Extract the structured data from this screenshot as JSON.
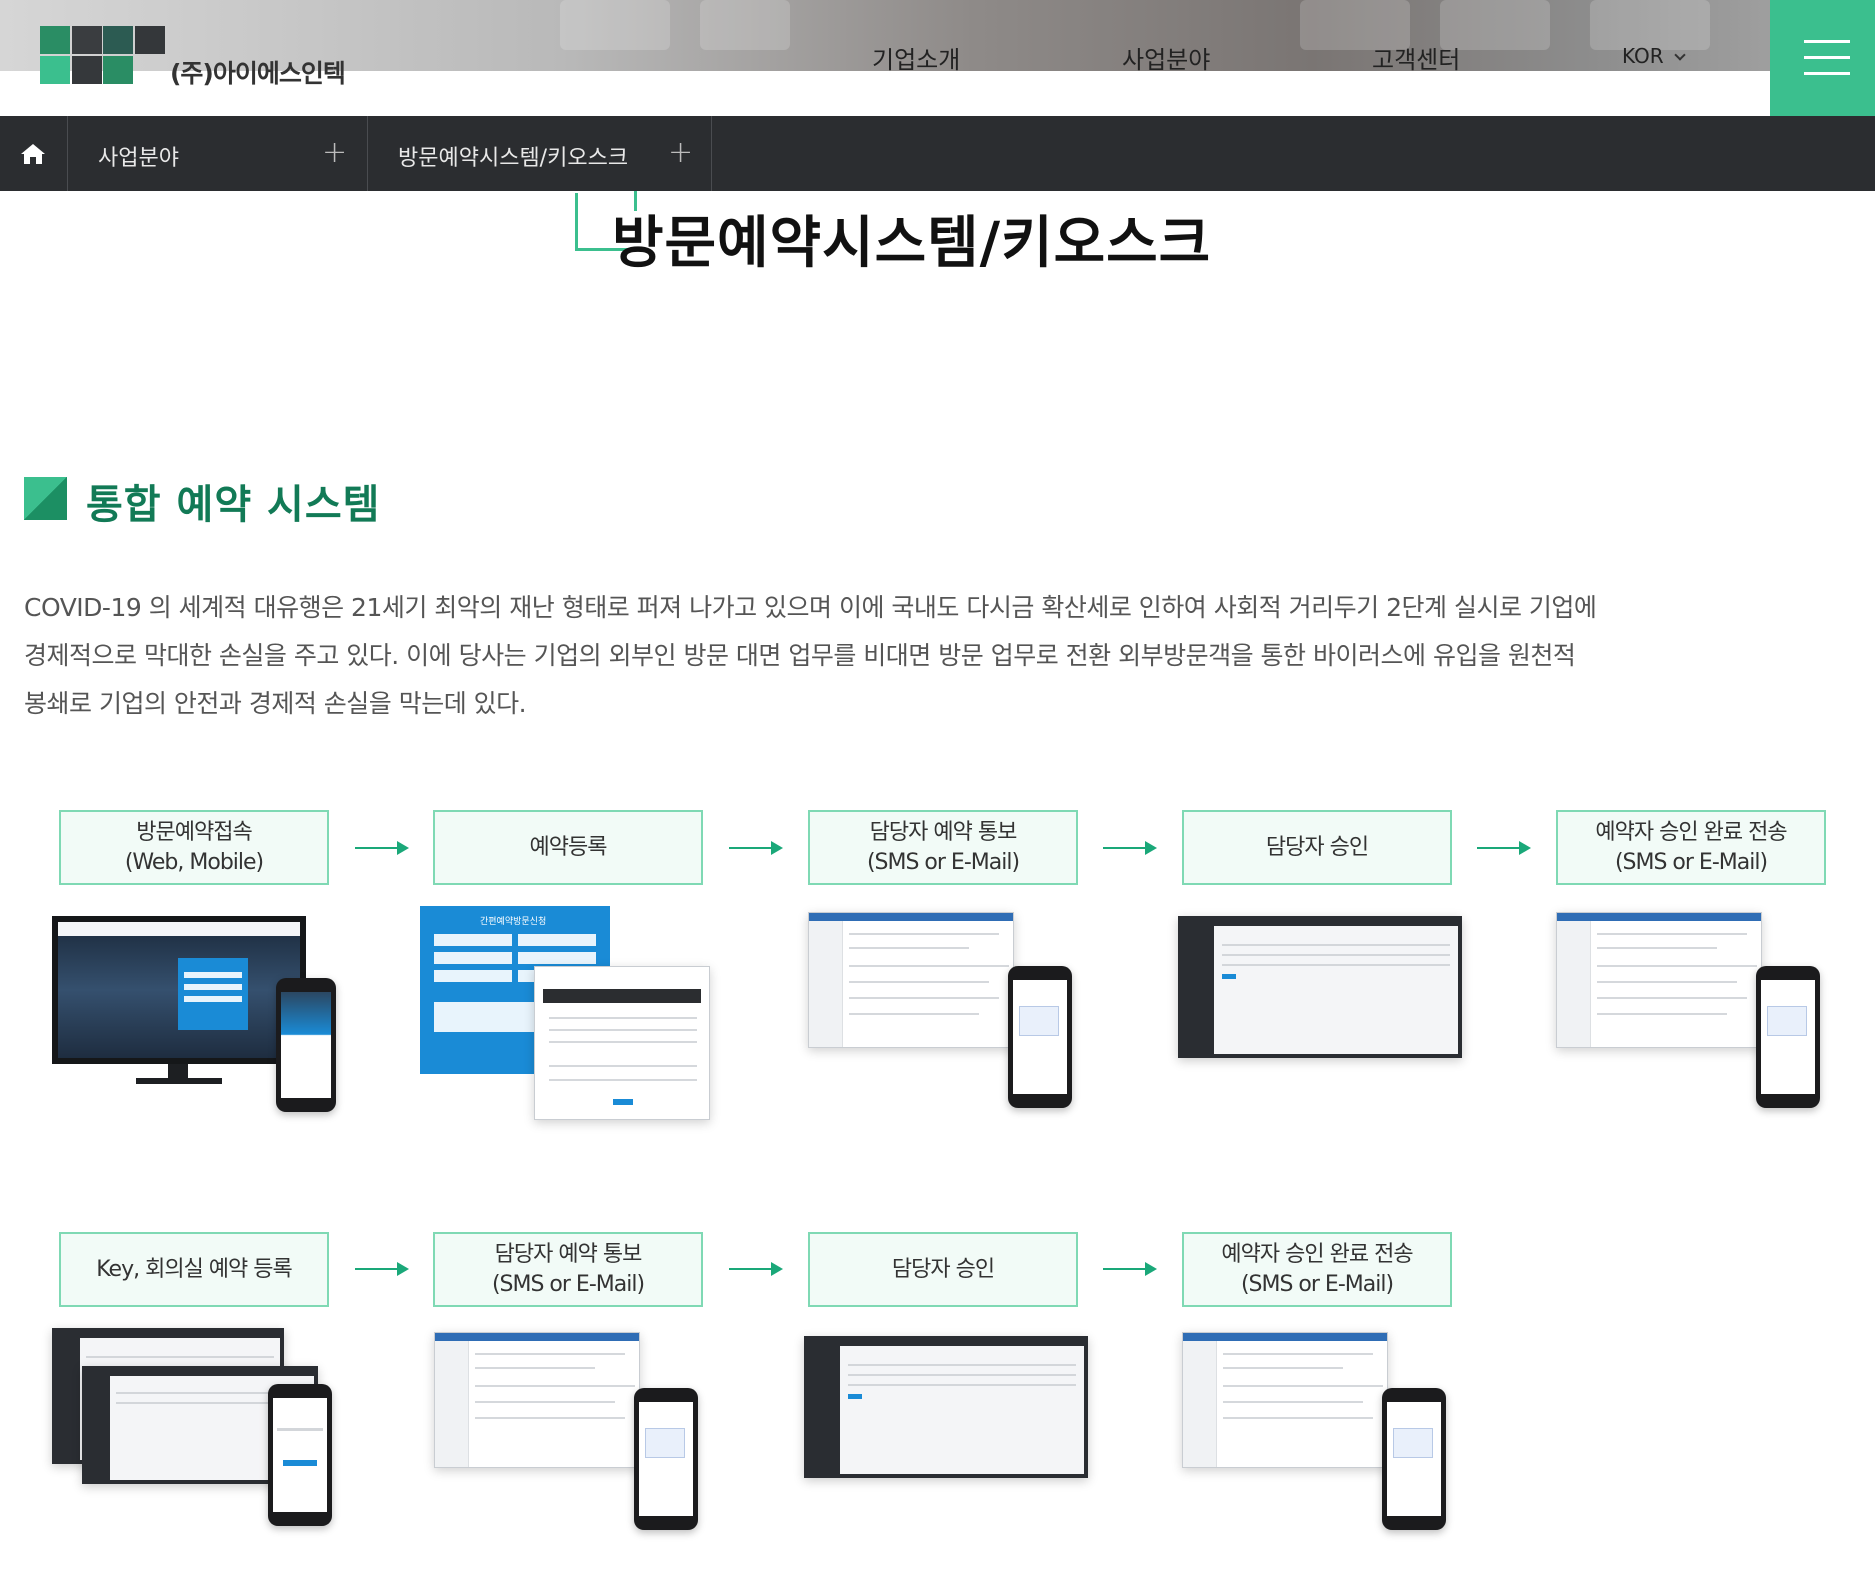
{
  "header": {
    "logo_text": "(주)아이에스인텍",
    "nav": [
      "기업소개",
      "사업분야",
      "고객센터"
    ],
    "lang": "KOR",
    "brand_color": "#3bbf8e"
  },
  "breadcrumb": {
    "home_icon": "home-icon",
    "items": [
      "사업분야",
      "방문예약시스템/키오스크"
    ]
  },
  "page": {
    "title": "방문예약시스템/키오스크"
  },
  "section": {
    "title": "통합 예약 시스템",
    "description_lines": [
      "COVID-19 의 세계적 대유행은 21세기 최악의 재난 형태로 퍼져 나가고 있으며 이에 국내도 다시금 확산세로 인하여 사회적 거리두기 2단계 실시로 기업에",
      "경제적으로 막대한 손실을 주고 있다. 이에 당사는 기업의 외부인 방문 대면 업무를 비대면 방문 업무로 전환 외부방문객을 통한 바이러스에 유입을 원천적",
      "봉쇄로 기업의 안전과 경제적 손실을 막는데 있다."
    ]
  },
  "flow1": [
    {
      "line1": "방문예약접속",
      "line2": "(Web, Mobile)"
    },
    {
      "line1": "예약등록",
      "line2": ""
    },
    {
      "line1": "담당자 예약 통보",
      "line2": "(SMS or E-Mail)"
    },
    {
      "line1": "담당자 승인",
      "line2": ""
    },
    {
      "line1": "예약자 승인 완료 전송",
      "line2": "(SMS or E-Mail)"
    }
  ],
  "flow2": [
    {
      "line1": "Key, 회의실 예약 등록",
      "line2": ""
    },
    {
      "line1": "담당자 예약 통보",
      "line2": "(SMS or E-Mail)"
    },
    {
      "line1": "담당자 승인",
      "line2": ""
    },
    {
      "line1": "예약자 승인 완료 전송",
      "line2": "(SMS or E-Mail)"
    }
  ],
  "form_title": "간편예약방문신청"
}
